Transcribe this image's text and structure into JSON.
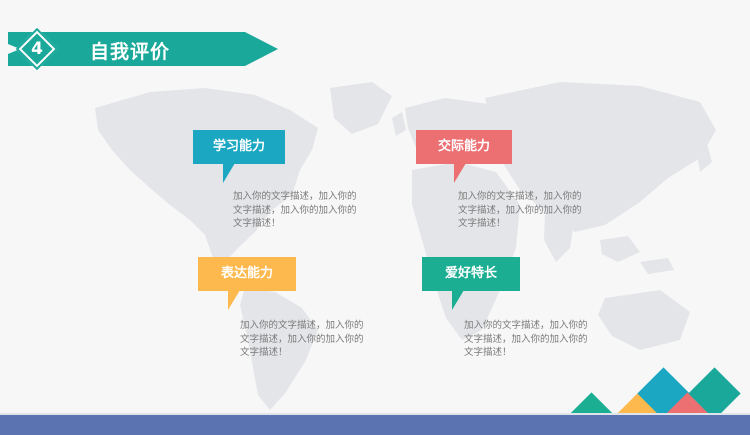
{
  "header": {
    "number": "4",
    "title": "自我评价"
  },
  "cards": [
    {
      "label": "学习能力",
      "description": "加入你的文字描述，加入你的文字描述，加入你的加入你的文字描述！",
      "color": "#1ba7c2"
    },
    {
      "label": "交际能力",
      "description": "加入你的文字描述，加入你的文字描述，加入你的加入你的文字描述！",
      "color": "#ec6f72"
    },
    {
      "label": "表达能力",
      "description": "加入你的文字描述，加入你的文字描述，加入你的加入你的文字描述！",
      "color": "#fdb94d"
    },
    {
      "label": "爱好特长",
      "description": "加入你的文字描述，加入你的文字描述，加入你的加入你的文字描述！",
      "color": "#1bae92"
    }
  ],
  "colors": {
    "teal": "#1aa89a",
    "cyan": "#1ba7c2",
    "coral": "#ec6f72",
    "orange": "#fdb94d",
    "green": "#1bae92",
    "frame": "#5b73b0"
  }
}
